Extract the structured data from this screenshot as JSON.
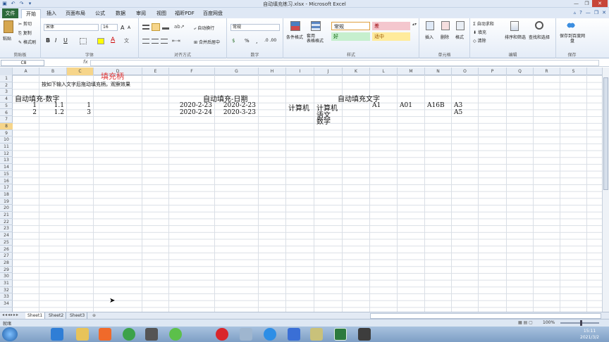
{
  "window": {
    "title": "自动填充练习.xlsx - Microsoft Excel",
    "qat": [
      "▣",
      "↶",
      "↷",
      "▾"
    ],
    "controls": [
      "—",
      "❐",
      "✕"
    ]
  },
  "tabs": [
    "文件",
    "开始",
    "插入",
    "页面布局",
    "公式",
    "数据",
    "审阅",
    "视图",
    "福昕PDF",
    "百度网盘"
  ],
  "ribbon": {
    "clipboard": {
      "label": "剪贴板",
      "paste": "粘贴",
      "cut": "剪切",
      "copy": "复制",
      "format_painter": "格式刷"
    },
    "font": {
      "label": "字体",
      "name": "宋体",
      "size": "16",
      "bold": "B",
      "italic": "I",
      "underline": "U",
      "grow": "A",
      "shrink": "A"
    },
    "alignment": {
      "label": "对齐方式",
      "wrap": "自动换行",
      "merge": "合并后居中"
    },
    "number": {
      "label": "数字",
      "format": "常规",
      "percent": "%",
      "comma": ","
    },
    "styles": {
      "label": "样式",
      "conditional": "条件格式",
      "table": "套用\n表格格式",
      "normal": "常规",
      "bad": "差",
      "good": "好",
      "neutral": "适中"
    },
    "cells": {
      "label": "单元格",
      "insert": "插入",
      "delete": "删除",
      "format": "格式"
    },
    "editing": {
      "label": "编辑",
      "autosum": "自动求和",
      "fill": "填充",
      "clear": "清除",
      "sort": "排序和筛选",
      "find": "查找和选择"
    },
    "save": {
      "label": "保存",
      "button": "保存到百度网盘"
    }
  },
  "formula_bar": {
    "name_box": "C8",
    "fx": "fx",
    "content": ""
  },
  "columns": [
    "A",
    "B",
    "C",
    "D",
    "E",
    "F",
    "G",
    "H",
    "I",
    "J",
    "K",
    "L",
    "M",
    "N",
    "O",
    "P",
    "Q",
    "R",
    "S"
  ],
  "rows": [
    "1",
    "2",
    "3",
    "4",
    "5",
    "6",
    "7",
    "8",
    "9",
    "10",
    "11",
    "12",
    "13",
    "14",
    "15",
    "16",
    "17",
    "18",
    "19",
    "20",
    "21",
    "22",
    "23",
    "24",
    "25",
    "26",
    "27",
    "28",
    "29",
    "30",
    "31",
    "32",
    "33",
    "34"
  ],
  "cells": {
    "title": "填充柄",
    "instruction": "按如下输入文字后拖动填充柄，观察效果",
    "number_header": "自动填充-数字",
    "date_header": "自动填充-日期",
    "text_header": "自动填充文字",
    "a5": "1",
    "b5": "1.1",
    "c5": "1",
    "a6": "2",
    "b6": "1.2",
    "c6": "3",
    "f5": "2020-2-23",
    "g5": "2020-2-23",
    "f6": "2020-2-24",
    "g6": "2020-3-23",
    "i5": "计算机",
    "j5": "计算机",
    "j6": "语文",
    "j7": "数学",
    "l5": "A1",
    "m5": "A01",
    "n5": "A16B",
    "o5": "A3",
    "o6": "A5"
  },
  "sheets": [
    "Sheet1",
    "Sheet2",
    "Sheet3"
  ],
  "sheet_nav": "◂◂◂▸▸▸",
  "status": {
    "ready": "就绪",
    "zoom": "100%"
  },
  "clock": {
    "time": "15:11",
    "date": "2021/3/2"
  },
  "colors": {
    "accent_green": "#2c6a3b",
    "title_red": "#e03a3a",
    "bad_fill": "#f4c7ce",
    "good_fill": "#c6efce",
    "neutral_fill": "#ffeb9c"
  }
}
